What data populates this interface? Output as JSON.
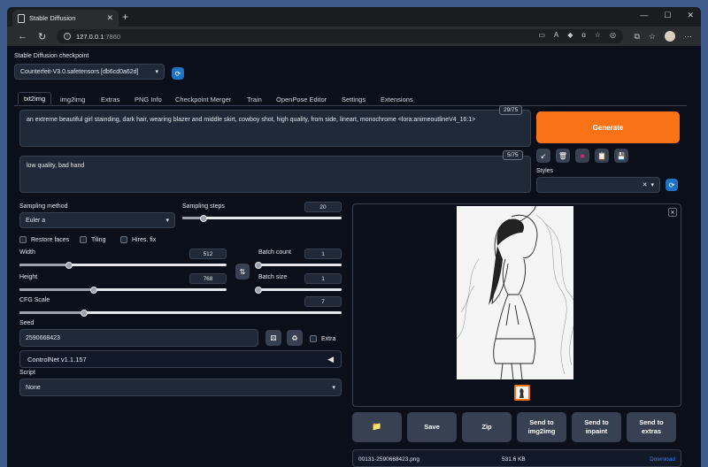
{
  "browser": {
    "tab_title": "Stable Diffusion",
    "url_host": "127.0.0.1",
    "url_port": ":7860"
  },
  "checkpoint": {
    "label": "Stable Diffusion checkpoint",
    "value": "Counterfeit-V3.0.safetensors [db6cd0a62d]"
  },
  "tabs": [
    "txt2img",
    "img2img",
    "Extras",
    "PNG Info",
    "Checkpoint Merger",
    "Train",
    "OpenPose Editor",
    "Settings",
    "Extensions"
  ],
  "prompt": {
    "text": "an extreme beautiful girl stainding, dark hair, wearing blazer and middle skirt, cowboy shot, high quality, from side, lineart, monochrome <lora:animeoutlineV4_16:1>",
    "counter": "29/75"
  },
  "negative_prompt": {
    "text": "low quality, bad hand",
    "counter": "5/75"
  },
  "generate_label": "Generate",
  "styles_label": "Styles",
  "sampling": {
    "method_label": "Sampling method",
    "method_value": "Euler a",
    "steps_label": "Sampling steps",
    "steps_value": "20",
    "steps_fraction": 0.133
  },
  "checks": {
    "restore_faces": "Restore faces",
    "tiling": "Tiling",
    "hires_fix": "Hires. fix"
  },
  "width": {
    "label": "Width",
    "value": "512",
    "fraction": 0.24
  },
  "height": {
    "label": "Height",
    "value": "768",
    "fraction": 0.36
  },
  "batch_count": {
    "label": "Batch count",
    "value": "1",
    "fraction": 0.0
  },
  "batch_size": {
    "label": "Batch size",
    "value": "1",
    "fraction": 0.0
  },
  "cfg": {
    "label": "CFG Scale",
    "value": "7",
    "fraction": 0.2
  },
  "seed": {
    "label": "Seed",
    "value": "2590668423",
    "extra_label": "Extra"
  },
  "controlnet_label": "ControlNet v1.1.157",
  "script": {
    "label": "Script",
    "value": "None"
  },
  "actions": {
    "save": "Save",
    "zip": "Zip",
    "send_img2img": "Send to\nimg2img",
    "send_inpaint": "Send to\ninpaint",
    "send_extras": "Send to\nextras"
  },
  "file": {
    "name": "00131-2590668423.png",
    "size": "531.6 KB",
    "download": "Download"
  },
  "colors": {
    "accent": "#f97316",
    "tool_blue": "#1d74c7"
  }
}
